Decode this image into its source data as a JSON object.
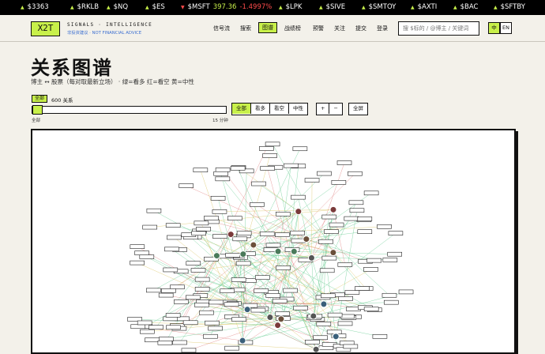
{
  "ticker": [
    {
      "sym": "$3363",
      "dir": "up"
    },
    {
      "sym": "$RKLB",
      "dir": "up"
    },
    {
      "sym": "$NQ",
      "dir": "up"
    },
    {
      "sym": "$ES",
      "dir": "up"
    },
    {
      "sym": "$MSFT",
      "dir": "down",
      "price": "397.36",
      "change": "-1.4997%"
    },
    {
      "sym": "$LPK",
      "dir": "up"
    },
    {
      "sym": "$SIVE",
      "dir": "up"
    },
    {
      "sym": "$SMTOY",
      "dir": "up"
    },
    {
      "sym": "$AXTI",
      "dir": "up"
    },
    {
      "sym": "$BAC",
      "dir": "up"
    },
    {
      "sym": "$SFTBY",
      "dir": "up"
    }
  ],
  "brand": {
    "logo": "X2T",
    "tagline": "SIGNALS · INTELLIGENCE",
    "disclaimer": "非投资建议 · NOT FINANCIAL ADVICE"
  },
  "nav": {
    "items": [
      "信号流",
      "搜索",
      "图谱",
      "战绩榜",
      "预警",
      "关注",
      "提交",
      "登录"
    ],
    "active_index": 2,
    "search_placeholder": "搜 $标的 / @博主 / 关键词",
    "lang_zh": "中",
    "lang_en": "EN"
  },
  "page": {
    "title": "关系图谱",
    "subtitle": "博主 ↔ 股票（每对取最新立场） · 绿=看多 红=看空 黄=中性"
  },
  "controls": {
    "all_badge": "全部",
    "count": "600 关系",
    "slider_min": "全部",
    "slider_max": "15 分钟",
    "slider_value": 0,
    "filters": [
      "全部",
      "看多",
      "看空",
      "中性"
    ],
    "filter_selected": 0,
    "zoom_in": "+",
    "zoom_out": "−",
    "fullscreen": "全屏"
  },
  "colors": {
    "accent": "#c8f04a",
    "bull_edge": "#5cc98a",
    "bear_edge": "#e07a7a",
    "neutral_edge": "#d9c25a",
    "down": "#ff4b4b"
  }
}
